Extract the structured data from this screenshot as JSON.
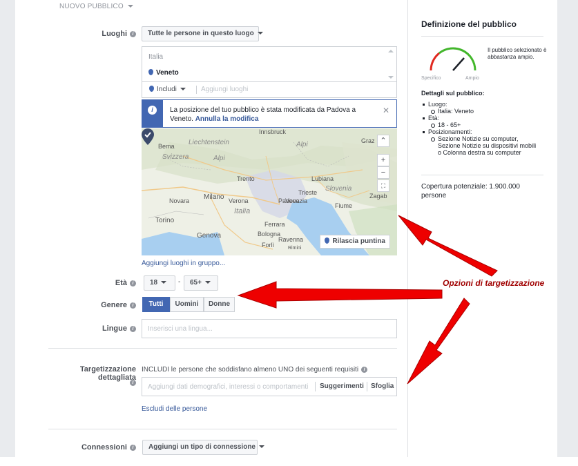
{
  "header": {
    "section_title": "NUOVO PUBBLICO"
  },
  "locations": {
    "label": "Luoghi",
    "dropdown": "Tutte le persone in questo luogo",
    "country": "Italia",
    "region": "Veneto",
    "include_label": "Includi",
    "add_placeholder": "Aggiungi luoghi",
    "notice_text": "La posizione del tuo pubblico è stata modificata da Padova a Veneto.",
    "notice_link": "Annulla la modifica",
    "add_group_link": "Aggiungi luoghi in gruppo..."
  },
  "map": {
    "release_pin": "Rilascia puntina",
    "zoom_in": "+",
    "zoom_out": "−",
    "labels": {
      "innsbruck": "Innsbruck",
      "graz": "Graz",
      "bema": "Bema",
      "liechtenstein": "Liechtenstein",
      "alpi": "Alpi",
      "svizzera": "Svizzera",
      "alpi2": "Alpi",
      "trento": "Trento",
      "lubiana": "Lubiana",
      "slovenia": "Slovenia",
      "trieste": "Trieste",
      "zagab": "Zagab",
      "novara": "Novara",
      "milano": "Milano",
      "verona": "Verona",
      "padova": "Padova",
      "venezia": "Venezia",
      "fiume": "Fiume",
      "torino": "Torino",
      "italia": "Italia",
      "ferrara": "Ferrara",
      "genova": "Genova",
      "bologna": "Bologna",
      "ravenna": "Ravenna",
      "forli": "Forlì",
      "rimini": "Rimini"
    }
  },
  "age": {
    "label": "Età",
    "min": "18",
    "max": "65+",
    "separator": "-"
  },
  "gender": {
    "label": "Genere",
    "options": [
      "Tutti",
      "Uomini",
      "Donne"
    ]
  },
  "languages": {
    "label": "Lingue",
    "placeholder": "Inserisci una lingua..."
  },
  "detailed": {
    "label": "Targetizzazione dettagliata",
    "description": "INCLUDI le persone che soddisfano almeno UNO dei seguenti requisiti",
    "placeholder": "Aggiungi dati demografici, interessi o comportamenti",
    "suggestions": "Suggerimenti",
    "browse": "Sfoglia",
    "exclude_link": "Escludi delle persone"
  },
  "connections": {
    "label": "Connessioni",
    "dropdown": "Aggiungi un tipo di connessione"
  },
  "sidebar": {
    "title": "Definizione del pubblico",
    "gauge_text": "Il pubblico selezionato è abbastanza ampio.",
    "gauge_left": "Specifico",
    "gauge_right": "Ampio",
    "details_title": "Dettagli sul pubblico:",
    "location_label": "Luogo:",
    "location_value": "Italia: Veneto",
    "age_label": "Età:",
    "age_value": "18 - 65+",
    "placements_label": "Posizionamenti:",
    "placements_value": "Sezione Notizie su computer, Sezione Notizie su dispositivi mobili o Colonna destra su computer",
    "coverage": "Copertura potenziale: 1.900.000 persone"
  },
  "annotation": "Opzioni di targetizzazione",
  "colors": {
    "accent": "#4267b2",
    "annotation": "#a00000",
    "arrow": "#ff0000"
  }
}
